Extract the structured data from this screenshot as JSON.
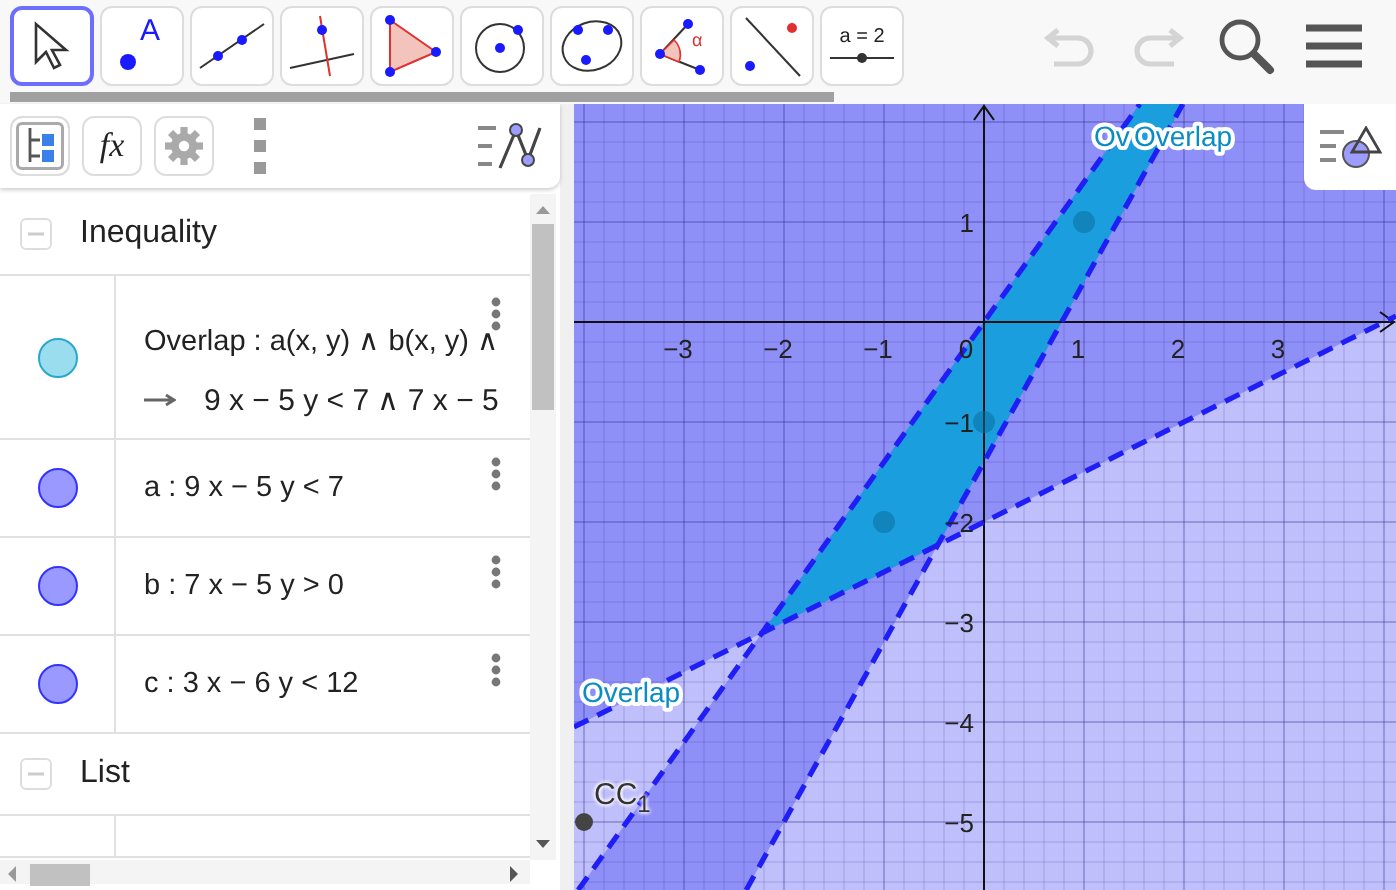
{
  "toolbar": {
    "tools": [
      {
        "kind": "move",
        "selected": true
      },
      {
        "kind": "point",
        "label": "A",
        "selected": false
      },
      {
        "kind": "line",
        "selected": false
      },
      {
        "kind": "perpendicular",
        "selected": false
      },
      {
        "kind": "polygon",
        "selected": false
      },
      {
        "kind": "circle",
        "selected": false
      },
      {
        "kind": "conic",
        "selected": false
      },
      {
        "kind": "angle",
        "label": "α",
        "selected": false
      },
      {
        "kind": "reflect",
        "selected": false
      },
      {
        "kind": "slider",
        "label": "a = 2",
        "selected": false
      }
    ],
    "undo": {
      "disabled": true
    },
    "redo": {
      "disabled": true
    }
  },
  "algebra": {
    "tabs": [
      {
        "kind": "tree",
        "selected": true
      },
      {
        "kind": "formula",
        "label": "fx",
        "selected": false
      },
      {
        "kind": "settings",
        "selected": false
      }
    ],
    "groups": [
      {
        "title": "Inequality",
        "expanded": true,
        "items": [
          {
            "definition": "Overlap : a(x, y) ∧ b(x, y) ∧",
            "value": "9 x − 5 y < 7 ∧ 7 x − 5",
            "color": "#99ddee",
            "visible": true
          },
          {
            "definition": "a : 9 x − 5 y < 7",
            "color": "#9999ff",
            "visible": true
          },
          {
            "definition": "b : 7 x − 5 y > 0",
            "color": "#9999ff",
            "visible": true
          },
          {
            "definition": "c : 3 x − 6 y < 12",
            "color": "#9999ff",
            "visible": true
          }
        ]
      },
      {
        "title": "List",
        "expanded": true
      }
    ]
  },
  "graphics": {
    "x_axis_labels": [
      "−3",
      "−2",
      "−1",
      "0",
      "1",
      "2",
      "3"
    ],
    "y_axis_labels": [
      "1",
      "−1",
      "−2",
      "−3",
      "−4",
      "−5"
    ],
    "object_labels": [
      "Ov",
      "Overlap",
      "Overlap"
    ],
    "point_label": "CC$_{1}$"
  }
}
